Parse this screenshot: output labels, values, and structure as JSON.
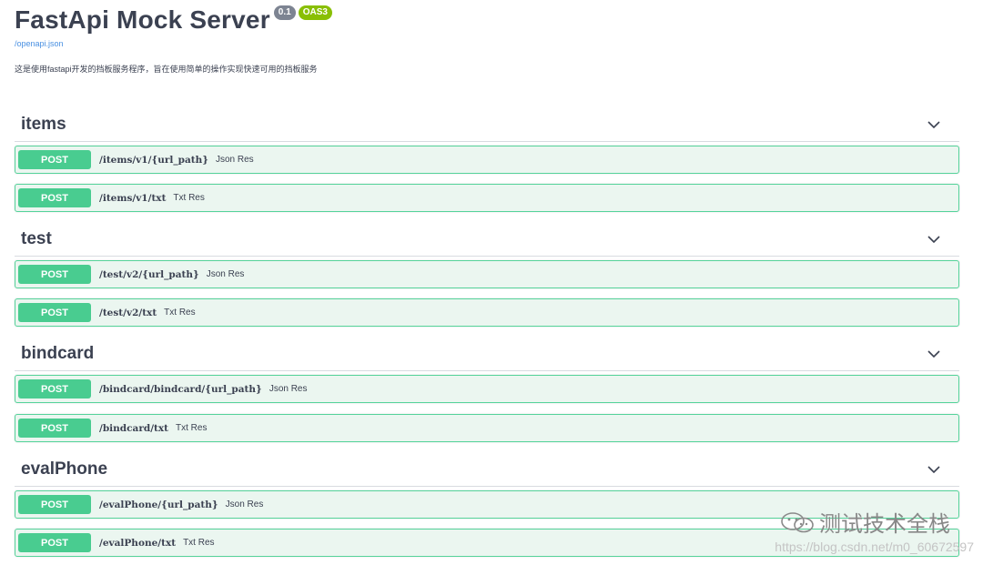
{
  "header": {
    "title": "FastApi Mock Server",
    "version": "0.1",
    "oas": "OAS3",
    "spec_link": "/openapi.json",
    "description": "这是使用fastapi开发的挡板服务程序，旨在使用简单的操作实现快速可用的挡板服务"
  },
  "sections": [
    {
      "name": "items",
      "ops": [
        {
          "method": "POST",
          "path": "/items/v1/{url_path}",
          "summary": "Json Res"
        },
        {
          "method": "POST",
          "path": "/items/v1/txt",
          "summary": "Txt Res"
        }
      ]
    },
    {
      "name": "test",
      "ops": [
        {
          "method": "POST",
          "path": "/test/v2/{url_path}",
          "summary": "Json Res"
        },
        {
          "method": "POST",
          "path": "/test/v2/txt",
          "summary": "Txt Res"
        }
      ]
    },
    {
      "name": "bindcard",
      "ops": [
        {
          "method": "POST",
          "path": "/bindcard/bindcard/{url_path}",
          "summary": "Json Res"
        },
        {
          "method": "POST",
          "path": "/bindcard/txt",
          "summary": "Txt Res"
        }
      ]
    },
    {
      "name": "evalPhone",
      "ops": [
        {
          "method": "POST",
          "path": "/evalPhone/{url_path}",
          "summary": "Json Res"
        },
        {
          "method": "POST",
          "path": "/evalPhone/txt",
          "summary": "Txt Res"
        }
      ]
    }
  ],
  "watermark": {
    "text": "测试技术全栈",
    "url": "https://blog.csdn.net/m0_60672597",
    "icon": "wechat-icon"
  },
  "colors": {
    "post": "#49cc90",
    "post_bg": "#ebf6f0",
    "post_border": "#55d39a",
    "version_badge": "#7d8492",
    "oas_badge": "#89bf04",
    "link": "#4990e2"
  }
}
